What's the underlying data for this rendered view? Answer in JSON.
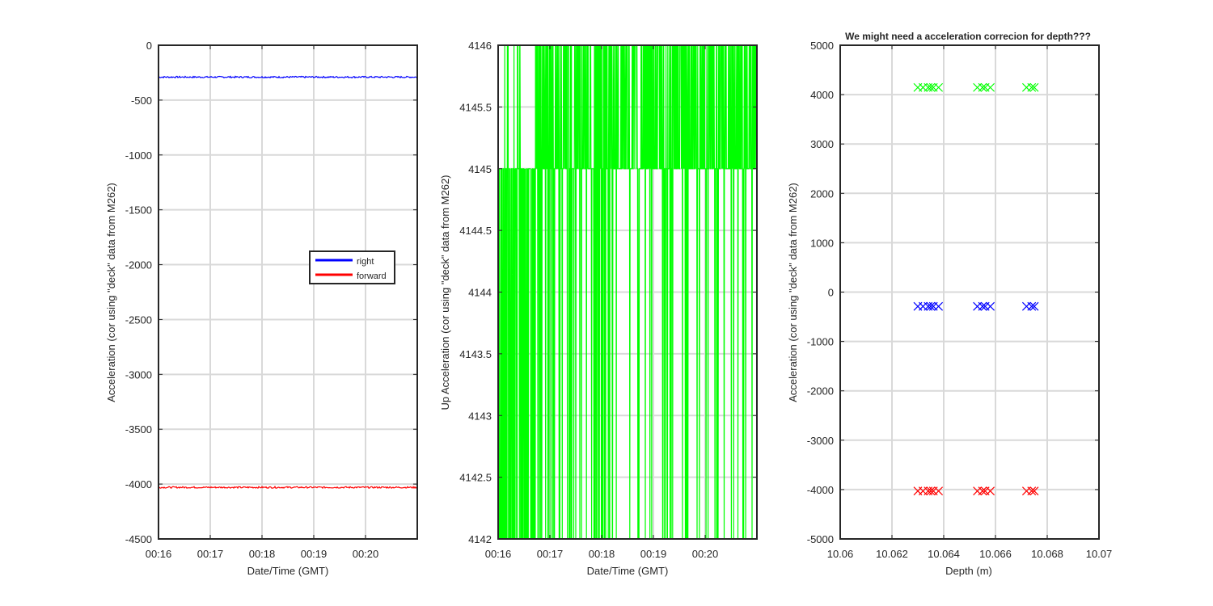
{
  "figure": {
    "background": "#ffffff",
    "axis_color": "#262626",
    "grid_color": "#d9d9d9"
  },
  "chart_data": [
    {
      "type": "line",
      "title": "",
      "xlabel": "Date/Time (GMT)",
      "ylabel": "Acceleration (cor using \"deck\" data from M262)",
      "x_ticks": [
        "00:16",
        "00:17",
        "00:18",
        "00:19",
        "00:20"
      ],
      "y_ticks": [
        0,
        -500,
        -1000,
        -1500,
        -2000,
        -2500,
        -3000,
        -3500,
        -4000,
        -4500
      ],
      "xlim": [
        "00:16:00",
        "00:21:00"
      ],
      "ylim": [
        -4500,
        0
      ],
      "grid": true,
      "legend": {
        "placement": "right-middle",
        "entries": [
          "right",
          "forward"
        ]
      },
      "series": [
        {
          "name": "right",
          "color": "#0000ff",
          "x": [
            "00:16:00",
            "00:21:00"
          ],
          "values": [
            -290,
            -290
          ]
        },
        {
          "name": "forward",
          "color": "#ff0000",
          "x": [
            "00:16:00",
            "00:21:00"
          ],
          "values": [
            -4030,
            -4030
          ]
        }
      ]
    },
    {
      "type": "line",
      "title": "",
      "xlabel": "Date/Time (GMT)",
      "ylabel": "Up Acceleration (cor using \"deck\" data from M262)",
      "x_ticks": [
        "00:16",
        "00:17",
        "00:18",
        "00:19",
        "00:20"
      ],
      "y_ticks": [
        4146,
        4145.5,
        4145,
        4144.5,
        4144,
        4143.5,
        4143,
        4142.5,
        4142
      ],
      "xlim": [
        "00:16:00",
        "00:21:00"
      ],
      "ylim": [
        4142,
        4146
      ],
      "grid": true,
      "series": [
        {
          "color": "#00ff00",
          "x": [
            "00:16:00",
            "00:21:00"
          ],
          "values": [
            4145,
            4145
          ],
          "noise_between": [
            4142,
            4146
          ]
        }
      ]
    },
    {
      "type": "scatter",
      "title": "We might need a acceleration correcion for depth???",
      "xlabel": "Depth (m)",
      "ylabel": "Acceleration (cor using \"deck\" data from M262)",
      "x_ticks": [
        "10.06",
        "10.062",
        "10.064",
        "10.066",
        "10.068",
        "10.07"
      ],
      "y_ticks": [
        5000,
        4000,
        3000,
        2000,
        1000,
        0,
        -1000,
        -2000,
        -3000,
        -4000,
        -5000
      ],
      "xlim": [
        10.06,
        10.07
      ],
      "ylim": [
        -5000,
        5000
      ],
      "grid": true,
      "marker": "x",
      "depths": [
        10.063,
        10.0632,
        10.0634,
        10.0635,
        10.0636,
        10.0638,
        10.0653,
        10.0655,
        10.0656,
        10.0658,
        10.0672,
        10.0674,
        10.0675
      ],
      "series": [
        {
          "color": "#00ff00",
          "y": 4145
        },
        {
          "color": "#0000ff",
          "y": -290
        },
        {
          "color": "#ff0000",
          "y": -4030
        }
      ]
    }
  ]
}
